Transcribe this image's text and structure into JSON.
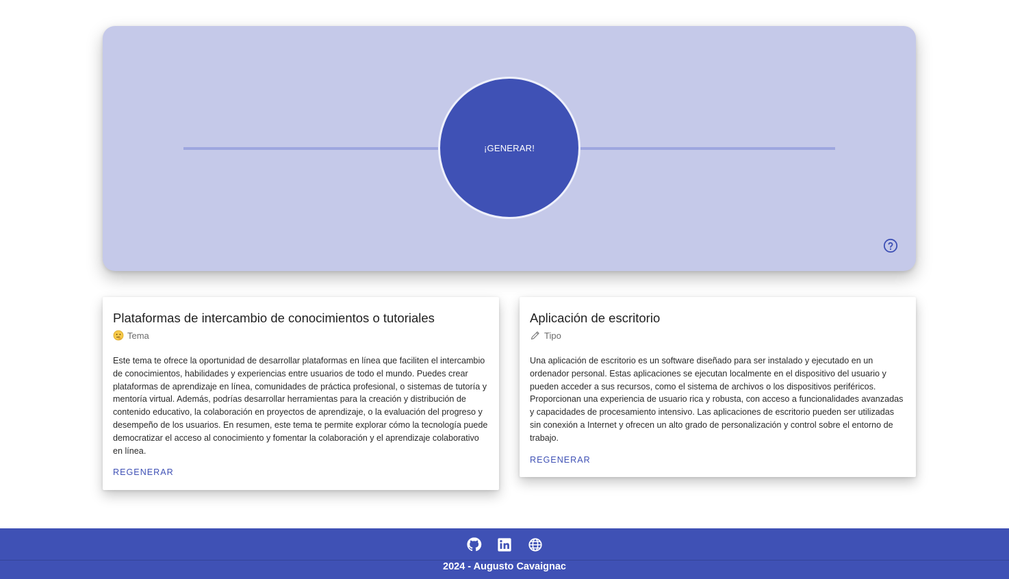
{
  "hero": {
    "generate_label": "¡GENERAR!",
    "help_icon": "help-circle-icon",
    "background_color": "#c5c9e9",
    "button_color": "#3f51b5"
  },
  "cards": [
    {
      "title": "Plataformas de intercambio de conocimientos o tutoriales",
      "subtitle": "Tema",
      "subtitle_icon": "thinking-face-icon",
      "body": "Este tema te ofrece la oportunidad de desarrollar plataformas en línea que faciliten el intercambio de conocimientos, habilidades y experiencias entre usuarios de todo el mundo. Puedes crear plataformas de aprendizaje en línea, comunidades de práctica profesional, o sistemas de tutoría y mentoría virtual. Además, podrías desarrollar herramientas para la creación y distribución de contenido educativo, la colaboración en proyectos de aprendizaje, o la evaluación del progreso y desempeño de los usuarios. En resumen, este tema te permite explorar cómo la tecnología puede democratizar el acceso al conocimiento y fomentar la colaboración y el aprendizaje colaborativo en línea.",
      "action_label": "REGENERAR"
    },
    {
      "title": "Aplicación de escritorio",
      "subtitle": "Tipo",
      "subtitle_icon": "pencil-icon",
      "body": "Una aplicación de escritorio es un software diseñado para ser instalado y ejecutado en un ordenador personal. Estas aplicaciones se ejecutan localmente en el dispositivo del usuario y pueden acceder a sus recursos, como el sistema de archivos o los dispositivos periféricos. Proporcionan una experiencia de usuario rica y robusta, con acceso a funcionalidades avanzadas y capacidades de procesamiento intensivo. Las aplicaciones de escritorio pueden ser utilizadas sin conexión a Internet y ofrecen un alto grado de personalización y control sobre el entorno de trabajo.",
      "action_label": "REGENERAR"
    }
  ],
  "footer": {
    "icons": [
      "github-icon",
      "linkedin-icon",
      "globe-icon"
    ],
    "text": "2024 - Augusto Cavaignac",
    "background_color": "#3f51b5"
  }
}
